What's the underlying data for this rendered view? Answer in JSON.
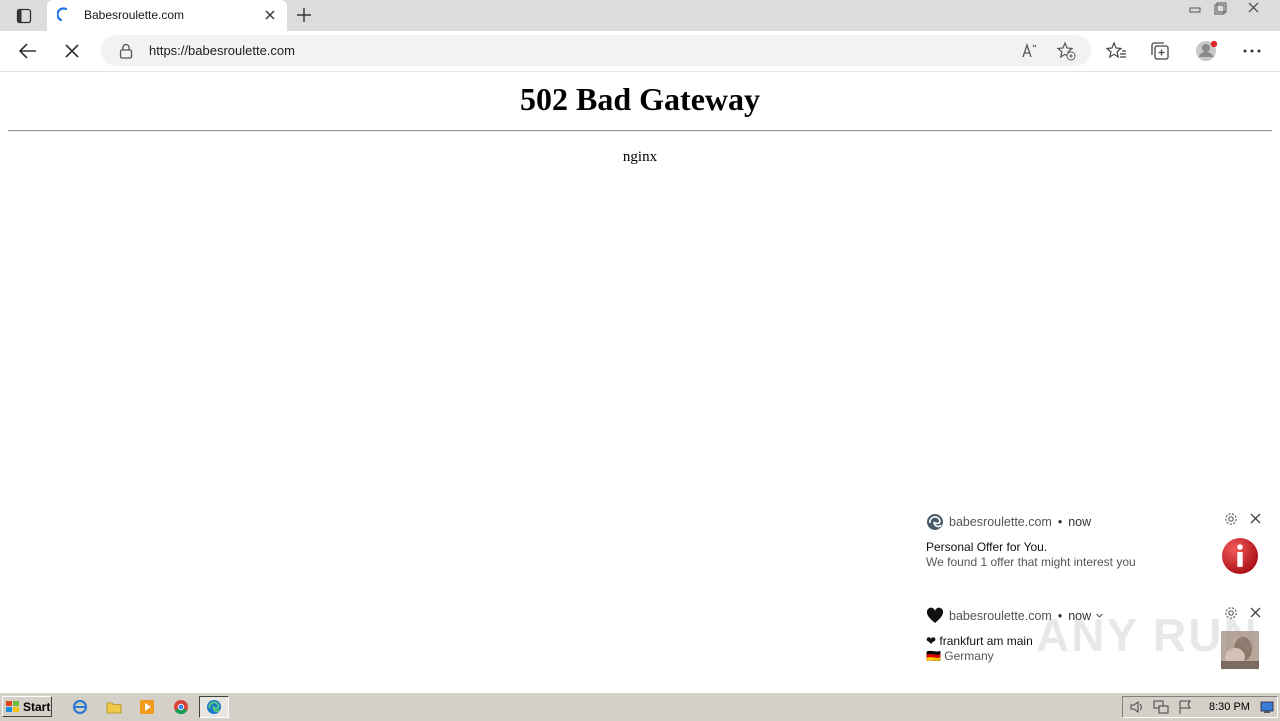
{
  "browser": {
    "tab": {
      "title": "Babesroulette.com"
    },
    "address": {
      "url": "https://babesroulette.com"
    },
    "icons": {
      "tab_actions": "tab-actions-icon",
      "favicon": "loading-spinner-icon",
      "tab_close": "close-icon",
      "new_tab": "plus-icon",
      "back": "arrow-left-icon",
      "stop": "close-icon",
      "lock": "lock-icon",
      "read_aloud": "read-aloud-icon",
      "add_favorite": "star-plus-icon",
      "favorites": "favorites-list-icon",
      "collections": "collections-icon",
      "profile": "avatar-icon",
      "menu": "ellipsis-icon"
    }
  },
  "page": {
    "heading": "502 Bad Gateway",
    "server": "nginx"
  },
  "notifications": [
    {
      "source": "babesroulette.com",
      "separator": "•",
      "time": "now",
      "title": "Personal Offer for You.",
      "body": "We found 1 offer that might interest you",
      "source_icon": "edge-icon",
      "image_icon": "info-icon"
    },
    {
      "source": "babesroulette.com",
      "separator": "•",
      "time": "now",
      "title": "❤ frankfurt am main",
      "body": "🇩🇪 Germany",
      "source_icon": "heart-icon",
      "image_icon": "photo-thumbnail"
    }
  ],
  "watermark": "ANY RUN",
  "taskbar": {
    "start_label": "Start",
    "clock": "8:30 PM"
  },
  "colors": {
    "tabstrip": "#dcdcdc",
    "address_bar": "#f2f2f2",
    "taskbar": "#d4d0c8",
    "info_red": "#c0161b"
  }
}
